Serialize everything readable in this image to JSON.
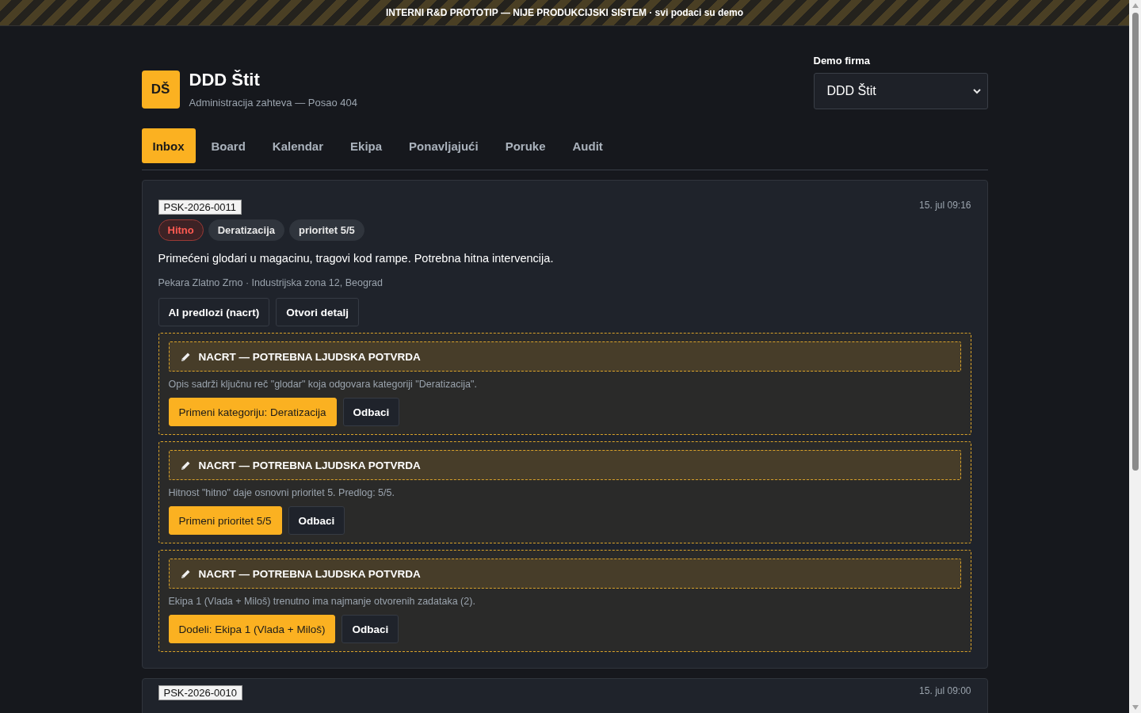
{
  "banner": {
    "text": "INTERNI R&D PROTOTIP — NIJE PRODUKCIJSKI SISTEM · svi podaci su demo"
  },
  "brand": {
    "logo": "DŠ",
    "name": "DDD Štit",
    "subtitle": "Administracija zahteva — Posao 404"
  },
  "company_select": {
    "label": "Demo firma",
    "value": "DDD Štit"
  },
  "tabs": [
    {
      "label": "Inbox",
      "selected": true
    },
    {
      "label": "Board",
      "selected": false
    },
    {
      "label": "Kalendar",
      "selected": false
    },
    {
      "label": "Ekipa",
      "selected": false
    },
    {
      "label": "Ponavljajući",
      "selected": false
    },
    {
      "label": "Poruke",
      "selected": false
    },
    {
      "label": "Audit",
      "selected": false
    }
  ],
  "requests": [
    {
      "id": "PSK-2026-0011",
      "time": "15. jul 09:16",
      "tags": [
        {
          "kind": "urgent",
          "label": "Hitno"
        },
        {
          "kind": "neutral",
          "label": "Deratizacija"
        },
        {
          "kind": "neutral",
          "label": "prioritet 5/5"
        }
      ],
      "description": "Primećeni glodari u magacinu, tragovi kod rampe. Potrebna hitna intervencija.",
      "location": "Pekara Zlatno Zrno · Industrijska zona 12, Beograd",
      "actions": [
        "AI predlozi (nacrt)",
        "Otvori detalj"
      ],
      "drafts": [
        {
          "title": "NACRT — POTREBNA LJUDSKA POTVRDA",
          "reason": "Opis sadrži ključnu reč \"glodar\" koja odgovara kategoriji \"Deratizacija\".",
          "apply": "Primeni kategoriju: Deratizacija",
          "dismiss": "Odbaci"
        },
        {
          "title": "NACRT — POTREBNA LJUDSKA POTVRDA",
          "reason": "Hitnost \"hitno\" daje osnovni prioritet 5. Predlog: 5/5.",
          "apply": "Primeni prioritet 5/5",
          "dismiss": "Odbaci"
        },
        {
          "title": "NACRT — POTREBNA LJUDSKA POTVRDA",
          "reason": "Ekipa 1 (Vlada + Miloš) trenutno ima najmanje otvorenih zadataka (2).",
          "apply": "Dodeli: Ekipa 1 (Vlada + Miloš)",
          "dismiss": "Odbaci"
        }
      ]
    },
    {
      "id": "PSK-2026-0010",
      "time": "15. jul 09:00"
    }
  ]
}
